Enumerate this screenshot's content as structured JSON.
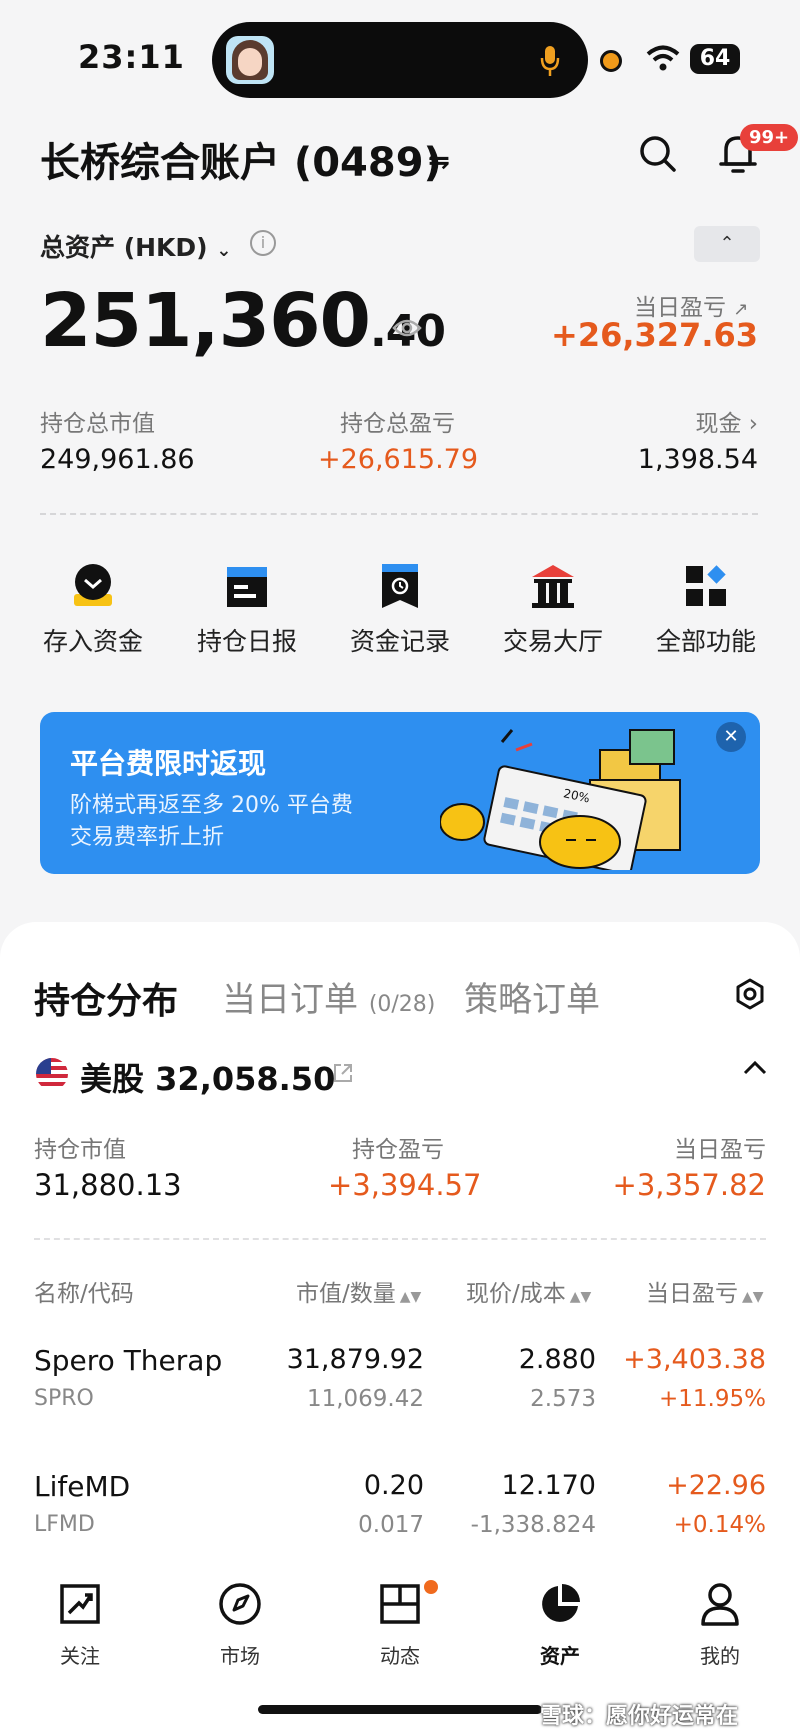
{
  "status_bar": {
    "time": "23:11",
    "battery": "64"
  },
  "header": {
    "account_title": "长桥综合账户 (0489)",
    "swap_glyph": "⇋",
    "notif_badge": "99+"
  },
  "summary": {
    "total_label": "总资产 (HKD)",
    "total_int": "251,360",
    "total_dec": ".40",
    "daily_pl_label": "当日盈亏",
    "daily_pl_value": "+26,327.63",
    "stats": [
      {
        "label": "持仓总市值",
        "value": "249,961.86"
      },
      {
        "label": "持仓总盈亏",
        "value": "+26,615.79"
      },
      {
        "label": "现金",
        "value": "1,398.54"
      }
    ]
  },
  "quick_actions": [
    {
      "label": "存入资金",
      "icon": "deposit-icon"
    },
    {
      "label": "持仓日报",
      "icon": "daily-report-icon"
    },
    {
      "label": "资金记录",
      "icon": "fund-record-icon"
    },
    {
      "label": "交易大厅",
      "icon": "trading-hall-icon"
    },
    {
      "label": "全部功能",
      "icon": "all-functions-icon"
    }
  ],
  "banner": {
    "title": "平台费限时返现",
    "line1": "阶梯式再返至多 20% 平台费",
    "line2": "交易费率折上折",
    "calc_text": "20%"
  },
  "holdings": {
    "tabs": [
      {
        "label": "持仓分布",
        "active": true
      },
      {
        "label": "当日订单",
        "count": "(0/28)"
      },
      {
        "label": "策略订单"
      }
    ],
    "market": {
      "name": "美股",
      "value": "32,058.50",
      "stats": [
        {
          "label": "持仓市值",
          "value": "31,880.13"
        },
        {
          "label": "持仓盈亏",
          "value": "+3,394.57"
        },
        {
          "label": "当日盈亏",
          "value": "+3,357.82"
        }
      ]
    },
    "columns": [
      "名称/代码",
      "市值/数量",
      "现价/成本",
      "当日盈亏"
    ],
    "rows": [
      {
        "name": "Spero Therap",
        "code": "SPRO",
        "mkt_value": "31,879.92",
        "qty": "11,069.42",
        "price": "2.880",
        "cost": "2.573",
        "dpl": "+3,403.38",
        "dpl_pct": "+11.95%"
      },
      {
        "name": "LifeMD",
        "code": "LFMD",
        "mkt_value": "0.20",
        "qty": "0.017",
        "price": "12.170",
        "cost": "-1,338.824",
        "dpl": "+22.96",
        "dpl_pct": "+0.14%"
      }
    ]
  },
  "bottom_nav": [
    {
      "label": "关注",
      "icon": "watchlist-icon"
    },
    {
      "label": "市场",
      "icon": "market-icon"
    },
    {
      "label": "动态",
      "icon": "feed-icon"
    },
    {
      "label": "资产",
      "icon": "assets-icon",
      "active": true
    },
    {
      "label": "我的",
      "icon": "profile-icon"
    }
  ],
  "watermark": "雪球：愿你好运常在",
  "colors": {
    "accent_orange": "#e55a1d",
    "banner_blue": "#2e8ff0",
    "badge_red": "#e8403a"
  }
}
